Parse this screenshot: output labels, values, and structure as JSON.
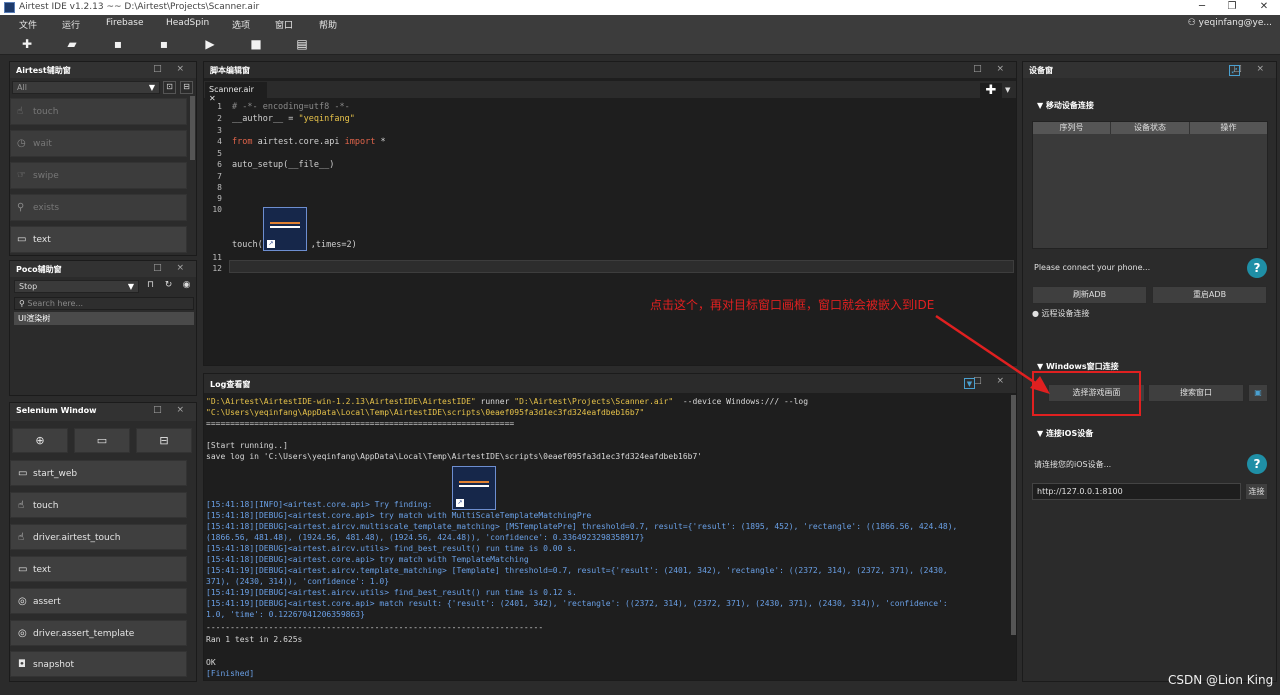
{
  "window": {
    "title": "Airtest IDE v1.2.13 ~~ D:\\Airtest\\Projects\\Scanner.air",
    "minimize": "─",
    "restore": "❐",
    "close": "✕"
  },
  "menu": [
    "文件",
    "运行",
    "Firebase",
    "HeadSpin",
    "选项",
    "窗口",
    "帮助"
  ],
  "user": "yeqinfang@ye...",
  "toolbar_icons": [
    "new-icon",
    "open-folder-icon",
    "save-icon",
    "save-as-icon",
    "run-icon",
    "stop-icon",
    "log-icon"
  ],
  "airtest_panel": {
    "title": "Airtest辅助窗",
    "filter": "All",
    "buttons": [
      "touch",
      "wait",
      "swipe",
      "exists",
      "text"
    ]
  },
  "poco_panel": {
    "title": "Poco辅助窗",
    "mode": "Stop",
    "search_placeholder": "Search here...",
    "tree_item": "UI渲染树"
  },
  "selenium_panel": {
    "title": "Selenium Window",
    "buttons": [
      "start_web",
      "touch",
      "driver.airtest_touch",
      "text",
      "assert",
      "driver.assert_template",
      "snapshot"
    ]
  },
  "editor": {
    "title": "脚本编辑窗",
    "tab": "Scanner.air",
    "lines": {
      "l1": "# -*- encoding=utf8 -*-",
      "l2a": "__author__ = ",
      "l2b": "\"yeqinfang\"",
      "l4a": "from",
      "l4b": " airtest.core.api ",
      "l4c": "import",
      "l4d": " *",
      "l6": "auto_setup(__file__)",
      "l10a": "touch(",
      "l10b": ",times=2)"
    },
    "line_numbers": [
      "1",
      "2",
      "3",
      "4",
      "5",
      "6",
      "7",
      "8",
      "9",
      "10",
      "11",
      "12"
    ]
  },
  "log": {
    "title": "Log查看窗",
    "cmd1a": "\"D:\\Airtest\\AirtestIDE-win-1.2.13\\AirtestIDE\\AirtestIDE\"",
    "cmd1b": " runner ",
    "cmd1c": "\"D:\\Airtest\\Projects\\Scanner.air\"",
    "cmd1d": "  --device Windows:/// --log",
    "cmd2": "\"C:\\Users\\yeqinfang\\AppData\\Local\\Temp\\AirtestIDE\\scripts\\0eaef095fa3d1ec3fd324eafdbeb16b7\"",
    "sep": "================================================================",
    "start": "[Start running..]",
    "savelog": "save log in 'C:\\Users\\yeqinfang\\AppData\\Local\\Temp\\AirtestIDE\\scripts\\0eaef095fa3d1ec3fd324eafdbeb16b7'",
    "l1": "[15:41:18][INFO]<airtest.core.api> Try finding:",
    "l2": "[15:41:18][DEBUG]<airtest.core.api> try match with MultiScaleTemplateMatchingPre",
    "l3": "[15:41:18][DEBUG]<airtest.aircv.multiscale_template_matching> [MSTemplatePre] threshold=0.7, result={'result': (1895, 452), 'rectangle': ((1866.56, 424.48),",
    "l4": "(1866.56, 481.48), (1924.56, 481.48), (1924.56, 424.48)), 'confidence': 0.3364923298358917}",
    "l5": "[15:41:18][DEBUG]<airtest.aircv.utils> find_best_result() run time is 0.00 s.",
    "l6": "[15:41:18][DEBUG]<airtest.core.api> try match with TemplateMatching",
    "l7": "[15:41:19][DEBUG]<airtest.aircv.template_matching> [Template] threshold=0.7, result={'result': (2401, 342), 'rectangle': ((2372, 314), (2372, 371), (2430,",
    "l8": "371), (2430, 314)), 'confidence': 1.0}",
    "l9": "[15:41:19][DEBUG]<airtest.aircv.utils> find_best_result() run time is 0.12 s.",
    "l10": "[15:41:19][DEBUG]<airtest.core.api> match result: {'result': (2401, 342), 'rectangle': ((2372, 314), (2372, 371), (2430, 371), (2430, 314)), 'confidence':",
    "l11": "1.0, 'time': 0.12267041206359863}",
    "sep2": "----------------------------------------------------------------------",
    "ran": "Ran 1 test in 2.625s",
    "ok": "OK",
    "finished": "[Finished]"
  },
  "device": {
    "title": "设备窗",
    "mobile_section": "▼ 移动设备连接",
    "columns": [
      "序列号",
      "设备状态",
      "操作"
    ],
    "connect_hint": "Please connect your phone...",
    "refresh_adb": "刷新ADB",
    "restart_adb": "重启ADB",
    "remote": "● 远程设备连接",
    "windows_section": "▼ Windows窗口连接",
    "select_game": "选择游戏画面",
    "search_window": "搜索窗口",
    "ios_section": "▼ 连接iOS设备",
    "ios_hint": "请连接您的iOS设备...",
    "ios_url": "http://127.0.0.1:8100",
    "connect": "连接"
  },
  "annotation": {
    "text": "点击这个，再对目标窗口画框，窗口就会被嵌入到IDE",
    "color": "#e02020"
  },
  "watermark": "CSDN @Lion King"
}
